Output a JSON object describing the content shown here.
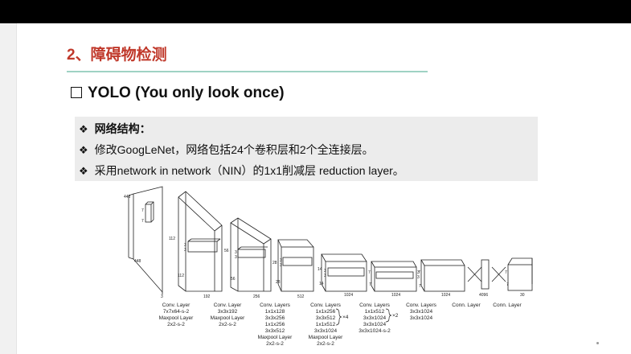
{
  "slide": {
    "title": "2、障碍物检测",
    "subtitle": "YOLO (You only look once)",
    "bullets": [
      "网络结构：",
      "修改GoogLeNet，网络包括24个卷积层和2个全连接层。",
      "采用network in network（NIN）的1x1削减层 reduction layer。"
    ]
  },
  "diagram": {
    "input_dims": [
      "448",
      "448",
      "3"
    ],
    "inner_dims": [
      "7",
      "7"
    ],
    "block_dims": [
      [
        "112",
        "112",
        "192",
        "3",
        "3"
      ],
      [
        "56",
        "56",
        "256",
        "3",
        "3"
      ],
      [
        "28",
        "28",
        "512",
        "3",
        "3"
      ],
      [
        "14",
        "14",
        "1024",
        "3",
        "3"
      ],
      [
        "7",
        "7",
        "1024",
        "3",
        "3"
      ],
      [
        "7",
        "7",
        "1024"
      ],
      [
        "4096"
      ],
      [
        "7",
        "7",
        "30"
      ]
    ],
    "layer_labels": [
      [
        "Conv. Layer",
        "7x7x64-s-2",
        "Maxpool Layer",
        "2x2-s-2"
      ],
      [
        "Conv. Layer",
        "3x3x192",
        "Maxpool Layer",
        "2x2-s-2"
      ],
      [
        "Conv. Layers",
        "1x1x128",
        "3x3x256",
        "1x1x256",
        "3x3x512",
        "Maxpool Layer",
        "2x2-s-2"
      ],
      [
        "Conv. Layers",
        "1x1x256",
        "3x3x512",
        "1x1x512",
        "3x3x1024",
        "Maxpool Layer",
        "2x2-s-2"
      ],
      [
        "Conv. Layers",
        "1x1x512",
        "3x3x1024",
        "3x3x1024",
        "3x3x1024-s-2"
      ],
      [
        "Conv. Layers",
        "3x3x1024",
        "3x3x1024"
      ],
      [
        "Conn. Layer"
      ],
      [
        "Conn. Layer"
      ]
    ],
    "repeat_marks": [
      "×4",
      "×2"
    ]
  }
}
